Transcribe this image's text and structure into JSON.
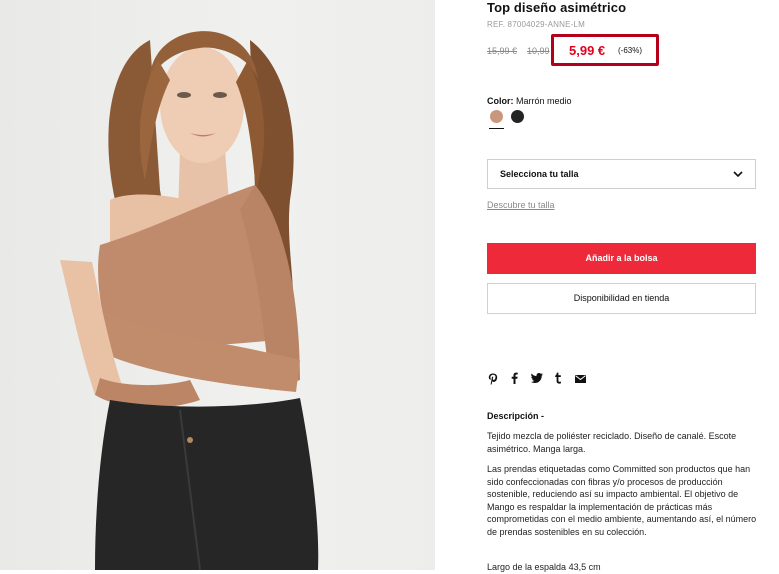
{
  "product": {
    "title": "Top diseño asimétrico",
    "ref": "REF. 87004029-ANNE-LM",
    "old_price_1": "15,99 €",
    "old_price_2": "10,99",
    "price": "5,99 €",
    "discount": "(-63%)",
    "price_color": "#e3001b",
    "highlight_color": "#b5001b"
  },
  "color": {
    "label": "Color:",
    "value": "Marrón medio",
    "swatches": [
      {
        "name": "brown",
        "hex": "#c9977d",
        "selected": true
      },
      {
        "name": "black",
        "hex": "#232323",
        "selected": false
      }
    ]
  },
  "size": {
    "select_label": "Selecciona tu talla",
    "guide_link": "Descubre tu talla"
  },
  "actions": {
    "add_to_bag": "Añadir a la bolsa",
    "add_to_bag_color": "#ee2a3a",
    "availability": "Disponibilidad en tienda"
  },
  "share": {
    "icons": [
      "pinterest-icon",
      "facebook-icon",
      "twitter-icon",
      "tumblr-icon",
      "email-icon"
    ],
    "glyphs": [
      "P",
      "f",
      "🐦",
      "t",
      "✉"
    ]
  },
  "description": {
    "heading": "Descripción -",
    "p1": "Tejido mezcla de poliéster reciclado. Diseño de canalé. Escote asimétrico. Manga larga.",
    "p2": "Las prendas etiquetadas como Committed son productos que han sido confeccionadas con fibras y/o procesos de producción sostenible, reduciendo así su impacto ambiental. El objetivo de Mango es respaldar la implementación de prácticas más comprometidas con el medio ambiente, aumentando así, el número de prendas sostenibles en su colección.",
    "p3": "Largo de la espalda 43,5 cm"
  }
}
